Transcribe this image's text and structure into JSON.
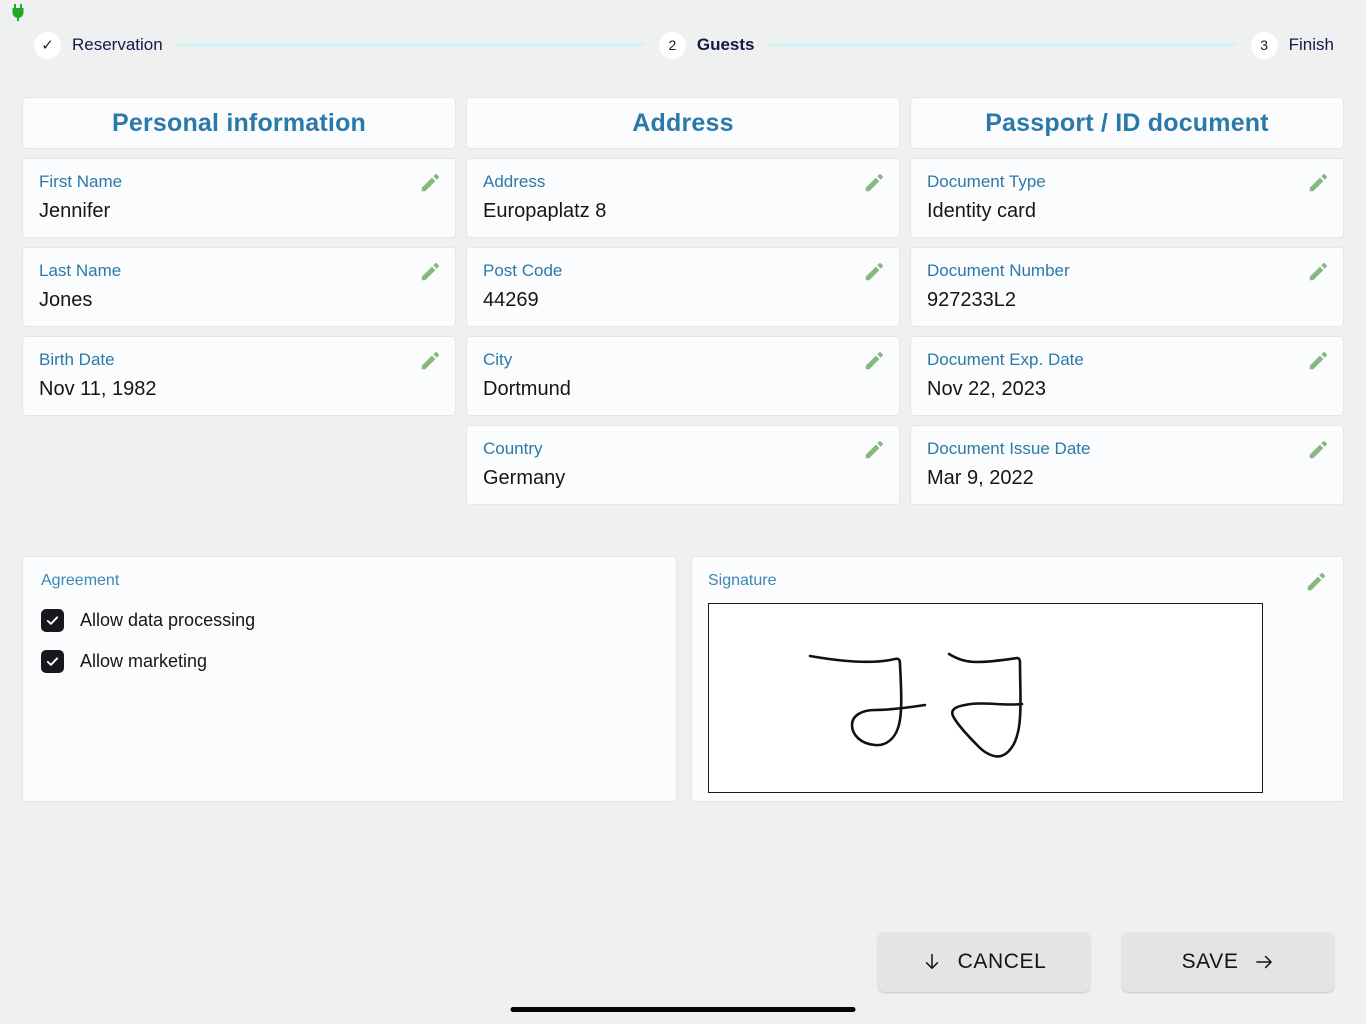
{
  "statusbar": {
    "icon": "power-plug-icon",
    "icon_color": "#23a825"
  },
  "stepper": {
    "steps": [
      {
        "badge": "✓",
        "label": "Reservation",
        "state": "done"
      },
      {
        "badge": "2",
        "label": "Guests",
        "state": "active"
      },
      {
        "badge": "3",
        "label": "Finish",
        "state": "upcoming"
      }
    ],
    "line_color": "#d6f3f3"
  },
  "columns": [
    {
      "title": "Personal information",
      "fields": [
        {
          "label": "First Name",
          "value": "Jennifer"
        },
        {
          "label": "Last Name",
          "value": "Jones"
        },
        {
          "label": "Birth Date",
          "value": "Nov 11, 1982"
        }
      ]
    },
    {
      "title": "Address",
      "fields": [
        {
          "label": "Address",
          "value": "Europaplatz 8"
        },
        {
          "label": "Post Code",
          "value": "44269"
        },
        {
          "label": "City",
          "value": "Dortmund"
        },
        {
          "label": "Country",
          "value": "Germany"
        }
      ]
    },
    {
      "title": "Passport / ID document",
      "fields": [
        {
          "label": "Document Type",
          "value": "Identity card"
        },
        {
          "label": "Document Number",
          "value": "927233L2"
        },
        {
          "label": "Document Exp. Date",
          "value": "Nov 22, 2023"
        },
        {
          "label": "Document Issue Date",
          "value": "Mar 9, 2022"
        }
      ]
    }
  ],
  "agreement": {
    "title": "Agreement",
    "items": [
      {
        "label": "Allow data processing",
        "checked": true
      },
      {
        "label": "Allow marketing",
        "checked": true
      }
    ]
  },
  "signature": {
    "title": "Signature",
    "content": "handwritten-signature-j-j"
  },
  "actions": {
    "cancel_label": "CANCEL",
    "cancel_icon": "arrow-down-icon",
    "save_label": "SAVE",
    "save_icon": "arrow-right-icon"
  },
  "theme": {
    "page_bg": "#eef1ef",
    "card_bg": "#fbfcfd",
    "card_border": "#e4e7e8",
    "heading_color": "#2b79a8",
    "label_color": "#2b79a8",
    "value_color": "#161616",
    "pencil_color": "#85b97e",
    "button_bg": "#e2e4e6"
  }
}
